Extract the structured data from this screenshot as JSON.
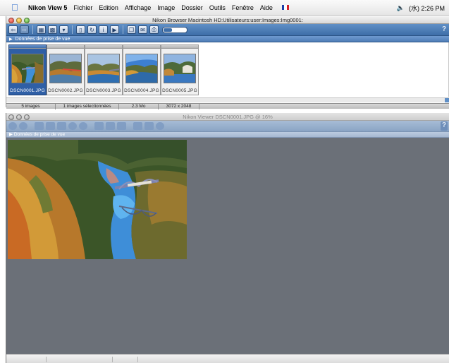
{
  "menubar": {
    "app_name": "Nikon View 5",
    "items": [
      "Fichier",
      "Edition",
      "Affichage",
      "Image",
      "Dossier",
      "Outils",
      "Fenêtre",
      "Aide"
    ],
    "clock": "(水) 2:26 PM",
    "speaker_icon": "speaker-icon",
    "flag_colors": [
      "#1d3fa8",
      "#ffffff",
      "#d6202a"
    ]
  },
  "browser": {
    "title": "Nikon Browser Macintosh HD:Utilisateurs:user:Images:Img0001:",
    "section_label": "Données de prise de vue",
    "help_label": "?",
    "thumbnails": [
      {
        "label": "DSCN0001.JPG",
        "selected": true
      },
      {
        "label": "DSCN0002.JPG",
        "selected": false
      },
      {
        "label": "DSCN0003.JPG",
        "selected": false
      },
      {
        "label": "DSCN0004.JPG",
        "selected": false
      },
      {
        "label": "DSCN0005.JPG",
        "selected": false
      }
    ],
    "status": {
      "image_count": "5 images",
      "selected_count": "1 images sélectionnées",
      "file_size": "2.3 Mo",
      "dimensions": "3072 x 2048"
    }
  },
  "viewer": {
    "title": "Nikon Viewer DSCN0001.JPG @ 16%",
    "section_label": "Données de prise de vue",
    "help_label": "?"
  },
  "colors": {
    "toolbar_blue": "#4f7db6",
    "selected_thumb": "#2f5fa6",
    "viewer_background": "#6b7078"
  }
}
